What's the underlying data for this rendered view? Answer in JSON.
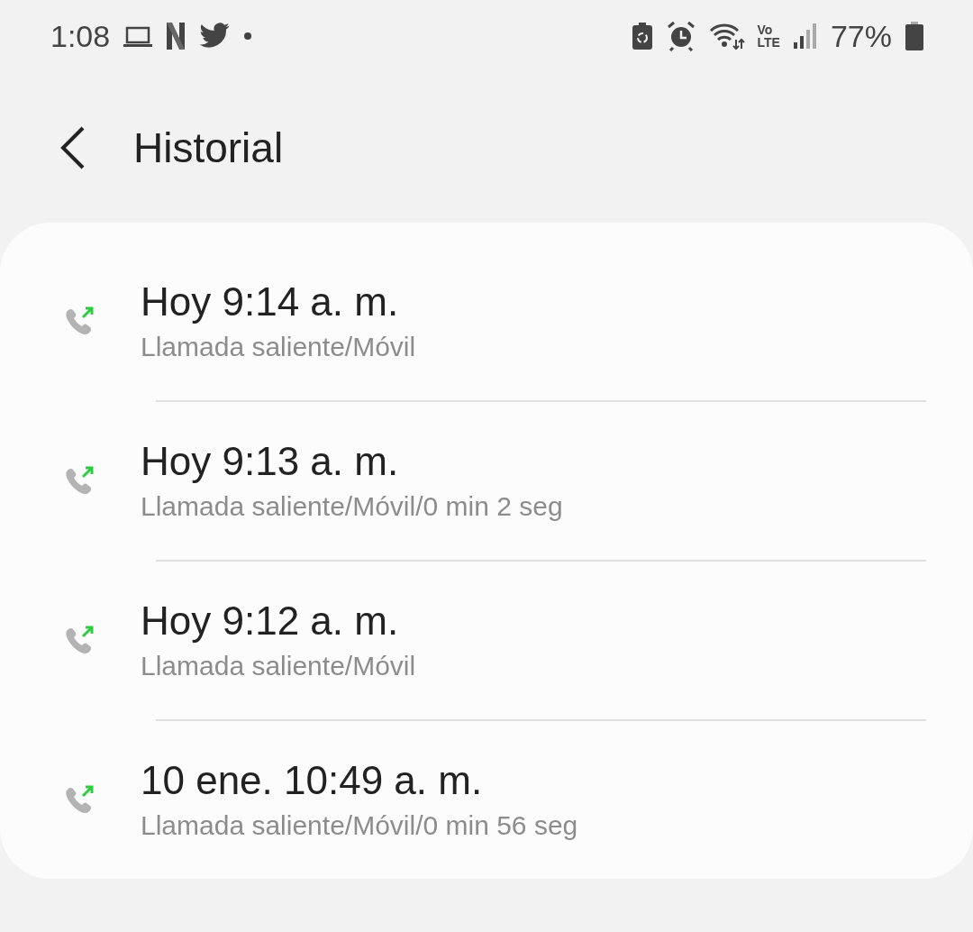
{
  "status_bar": {
    "time": "1:08",
    "volte": [
      "Vo",
      "LTE"
    ],
    "battery": "77%"
  },
  "header": {
    "title": "Historial"
  },
  "calls": [
    {
      "kind": "outgoing",
      "time": "Hoy 9:14 a. m.",
      "detail": "Llamada saliente/Móvil"
    },
    {
      "kind": "outgoing",
      "time": "Hoy 9:13 a. m.",
      "detail": "Llamada saliente/Móvil/0 min 2 seg"
    },
    {
      "kind": "outgoing",
      "time": "Hoy 9:12 a. m.",
      "detail": "Llamada saliente/Móvil"
    },
    {
      "kind": "outgoing",
      "time": "10 ene. 10:49 a. m.",
      "detail": "Llamada saliente/Móvil/0 min 56 seg"
    }
  ]
}
